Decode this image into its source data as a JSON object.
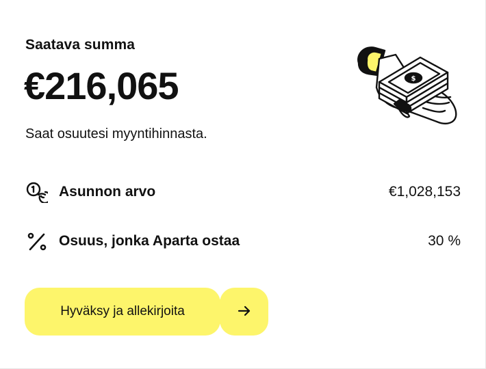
{
  "summary": {
    "label": "Saatava summa",
    "amount": "€216,065",
    "subtitle": "Saat osuutesi myyntihinnasta."
  },
  "details": [
    {
      "icon": "coins-icon",
      "label": "Asunnon arvo",
      "value": "€1,028,153"
    },
    {
      "icon": "percent-icon",
      "label": "Osuus, jonka Aparta ostaa",
      "value": "30 %"
    }
  ],
  "actions": {
    "primary_label": "Hyväksy ja allekirjoita",
    "arrow_icon": "arrow-right-icon"
  },
  "illustration": {
    "icon": "hand-holding-money-icon"
  },
  "colors": {
    "accent": "#fdf56b",
    "text": "#111111",
    "background": "#ffffff"
  }
}
